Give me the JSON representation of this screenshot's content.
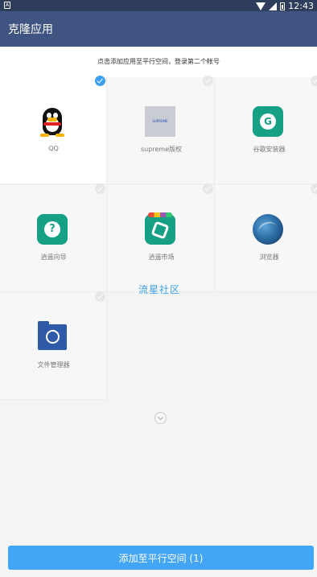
{
  "status_bar": {
    "time": "12:43"
  },
  "app_bar": {
    "title": "克隆应用"
  },
  "hint": "点击添加应用至平行空间，登录第二个帐号",
  "apps": [
    {
      "label": "QQ",
      "selected": true
    },
    {
      "label": "supreme版权",
      "selected": false
    },
    {
      "label": "谷歌安装器",
      "selected": false
    },
    {
      "label": "逍遥向导",
      "selected": false
    },
    {
      "label": "逍遥市场",
      "selected": false
    },
    {
      "label": "浏览器",
      "selected": false
    },
    {
      "label": "文件管理器",
      "selected": false
    }
  ],
  "watermark": "流星社区",
  "supreme_image_text": "SUPREME",
  "add_button": "添加至平行空间 (1)",
  "colors": {
    "app_bar": "#3f5480",
    "accent": "#42a5f5",
    "selected_check": "#3ba0f2"
  }
}
